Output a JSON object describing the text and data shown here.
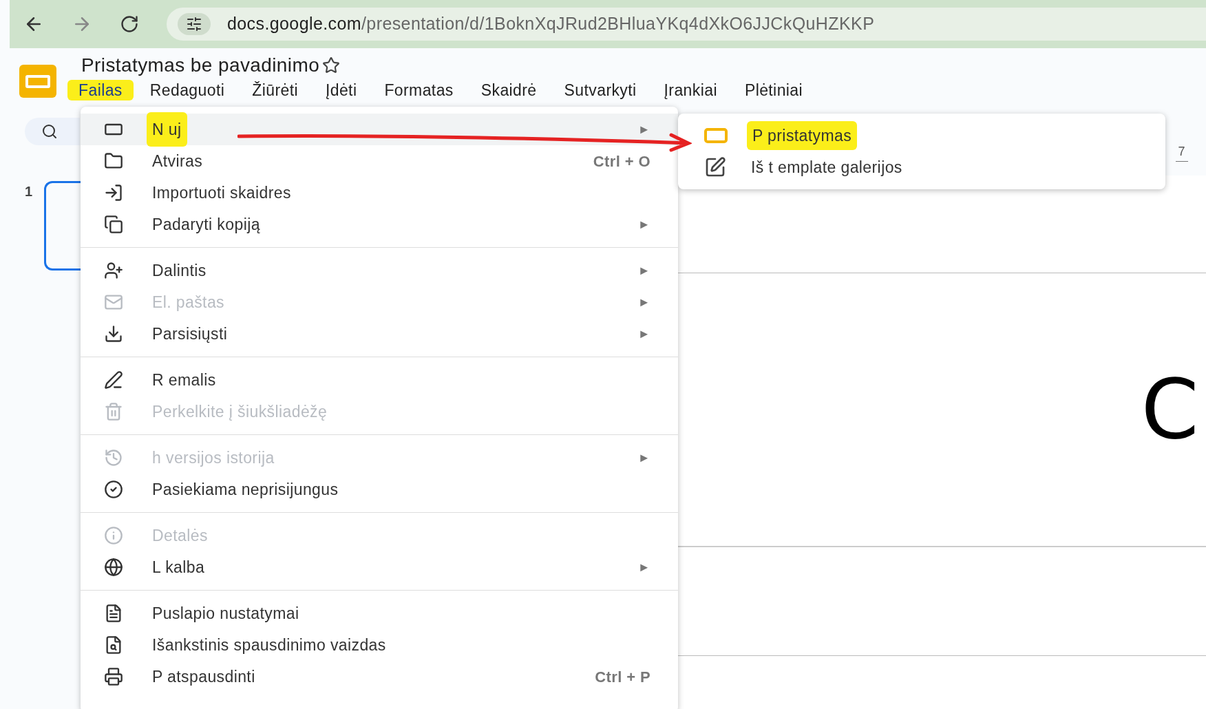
{
  "browser": {
    "url_host": "docs.google.com",
    "url_path": "/presentation/d/1BoknXqJRud2BHluaYKq4dXkO6JJCkQuHZKKP"
  },
  "document": {
    "title": "Pristatymas be pavadinimo"
  },
  "menu_bar": [
    {
      "label": "Failas",
      "selected": true,
      "highlighted": true
    },
    {
      "label": "Redaguoti",
      "selected": false,
      "highlighted": false
    },
    {
      "label": "Žiūrėti",
      "selected": false,
      "highlighted": false
    },
    {
      "label": "Įdėti",
      "selected": false,
      "highlighted": false
    },
    {
      "label": "Formatas",
      "selected": false,
      "highlighted": false
    },
    {
      "label": "Skaidrė",
      "selected": false,
      "highlighted": false
    },
    {
      "label": "Sutvarkyti",
      "selected": false,
      "highlighted": false
    },
    {
      "label": "Įrankiai",
      "selected": false,
      "highlighted": false
    },
    {
      "label": "Plėtiniai",
      "selected": false,
      "highlighted": false
    }
  ],
  "slide_panel": {
    "slide_number": "1"
  },
  "ruler": {
    "tick_label": "7"
  },
  "slide": {
    "text": "C"
  },
  "file_menu": [
    [
      {
        "label": "N uj",
        "arrow": "►",
        "disabled": false,
        "highlighted": true,
        "selected": true
      },
      {
        "label": "Atviras",
        "shortcut": "Ctrl + O",
        "disabled": false,
        "highlighted": false,
        "selected": false
      },
      {
        "label": "Importuoti skaidres",
        "disabled": false,
        "highlighted": false,
        "selected": false
      },
      {
        "label": "Padaryti kopiją",
        "arrow": "►",
        "disabled": false,
        "highlighted": false,
        "selected": false
      }
    ],
    [
      {
        "label": "Dalintis",
        "arrow": "►",
        "disabled": false,
        "highlighted": false,
        "selected": false
      },
      {
        "label": "El. paštas",
        "arrow": "►",
        "disabled": true,
        "highlighted": false,
        "selected": false
      },
      {
        "label": "Parsisiųsti",
        "arrow": "►",
        "disabled": false,
        "highlighted": false,
        "selected": false
      }
    ],
    [
      {
        "label": "R emalis",
        "disabled": false,
        "highlighted": false,
        "selected": false
      },
      {
        "label": "Perkelkite į šiukšliadėžę",
        "disabled": true,
        "highlighted": false,
        "selected": false
      }
    ],
    [
      {
        "label": "h versijos istorija",
        "arrow": "►",
        "disabled": true,
        "highlighted": false,
        "selected": false
      },
      {
        "label": "Pasiekiama neprisijungus",
        "disabled": false,
        "highlighted": false,
        "selected": false
      }
    ],
    [
      {
        "label": "Detalės",
        "disabled": true,
        "highlighted": false,
        "selected": false
      },
      {
        "label": "L kalba",
        "arrow": "►",
        "disabled": false,
        "highlighted": false,
        "selected": false
      }
    ],
    [
      {
        "label": "Puslapio nustatymai",
        "disabled": false,
        "highlighted": false,
        "selected": false
      },
      {
        "label": "Išankstinis spausdinimo vaizdas",
        "disabled": false,
        "highlighted": false,
        "selected": false
      },
      {
        "label": "P atspausdinti",
        "shortcut": "Ctrl + P",
        "disabled": false,
        "highlighted": false,
        "selected": false
      }
    ]
  ],
  "submenu": [
    {
      "label": "P pristatymas",
      "highlighted": true
    },
    {
      "label": "Iš t emplate galerijos",
      "highlighted": false
    }
  ]
}
